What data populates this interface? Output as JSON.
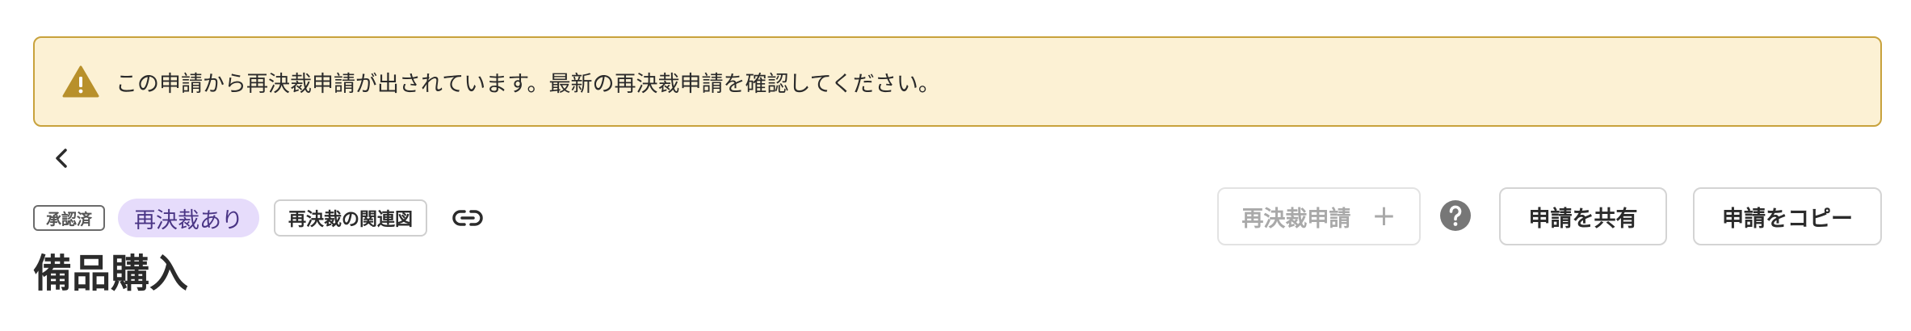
{
  "banner": {
    "message": "この申請から再決裁申請が出されています。最新の再決裁申請を確認してください。",
    "icon": "warning-icon",
    "background_color": "#fcf1d4",
    "border_color": "#c8a23c",
    "icon_color": "#b8902b"
  },
  "navigation": {
    "back_icon": "chevron-left-icon"
  },
  "status": {
    "approved_label": "承認済",
    "redecision_label": "再決裁あり",
    "redecision_color": "#e6dcfb",
    "relation_label": "再決裁の関連図",
    "link_icon": "link-icon"
  },
  "actions": {
    "redecision_request_label": "再決裁申請",
    "redecision_plus": "+",
    "help_icon": "question-circle-icon",
    "share_label": "申請を共有",
    "copy_label": "申請をコピー"
  },
  "request": {
    "title": "備品購入"
  }
}
